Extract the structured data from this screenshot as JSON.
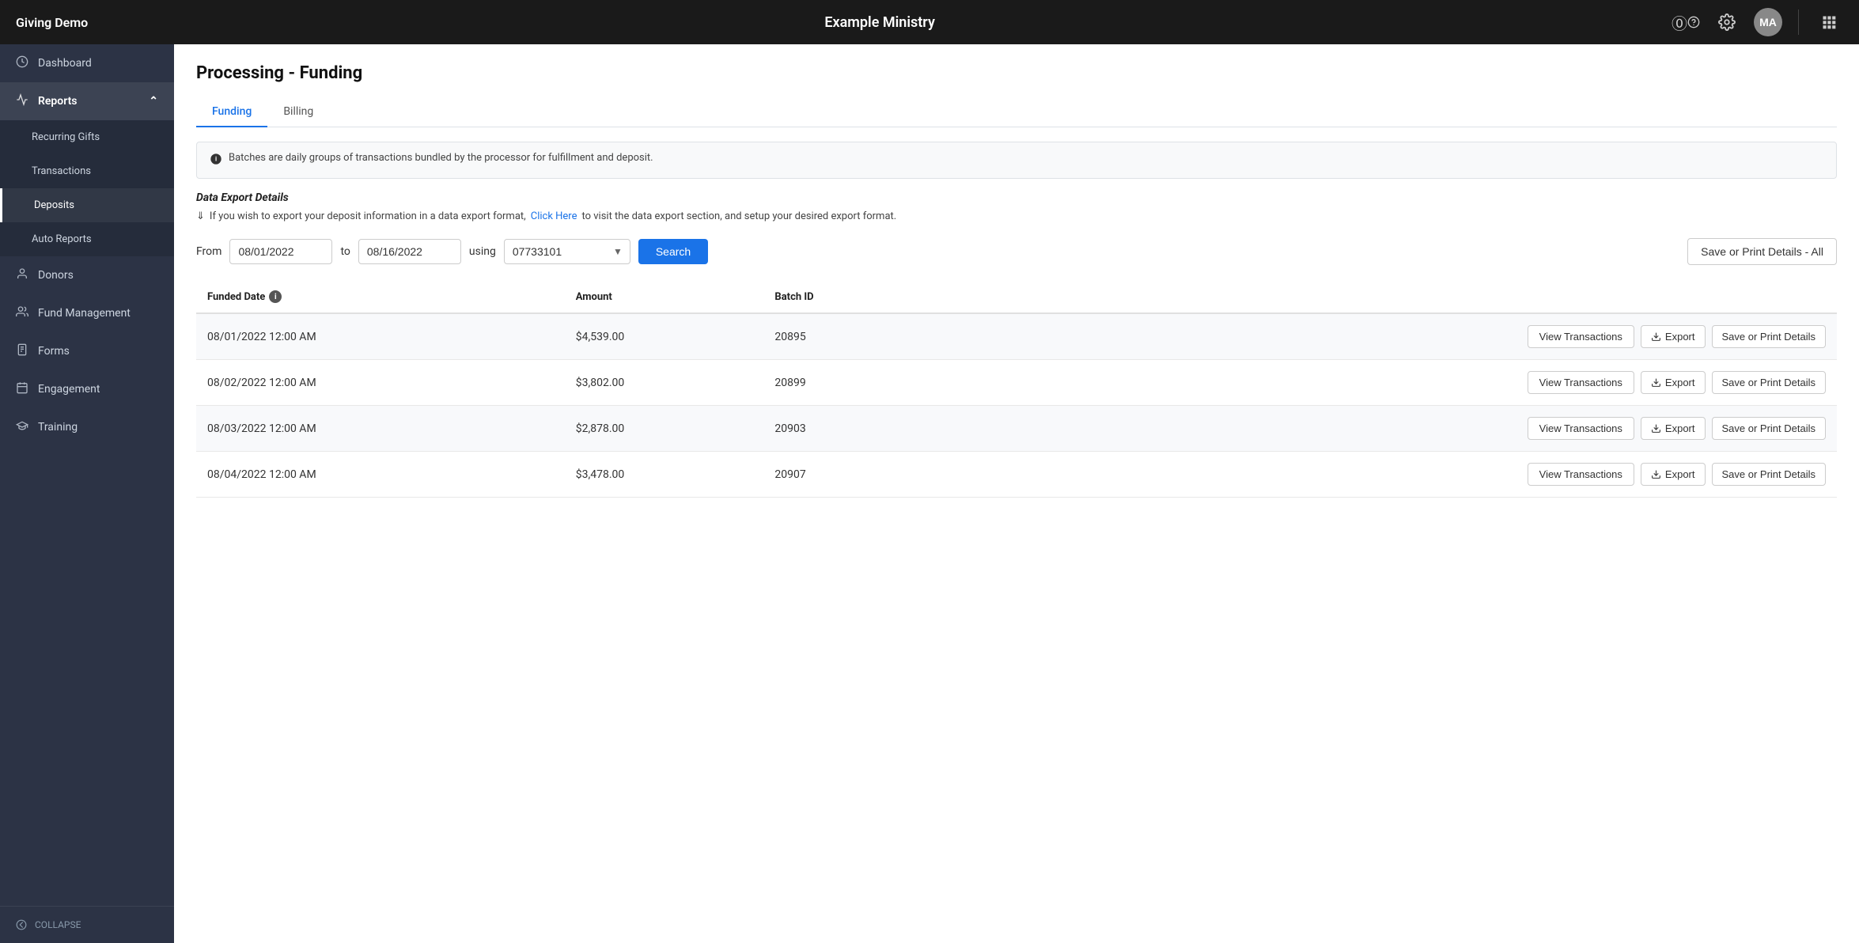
{
  "topnav": {
    "brand": "Giving Demo",
    "title": "Example Ministry",
    "avatar_initials": "MA",
    "help_icon": "?",
    "settings_icon": "⚙"
  },
  "sidebar": {
    "items": [
      {
        "id": "dashboard",
        "label": "Dashboard",
        "icon": "🕐"
      },
      {
        "id": "reports",
        "label": "Reports",
        "icon": "📈",
        "expanded": true
      },
      {
        "id": "recurring-gifts",
        "label": "Recurring Gifts",
        "sub": true
      },
      {
        "id": "transactions",
        "label": "Transactions",
        "sub": true
      },
      {
        "id": "deposits",
        "label": "Deposits",
        "sub": true,
        "active": true
      },
      {
        "id": "auto-reports",
        "label": "Auto Reports",
        "sub": true
      },
      {
        "id": "donors",
        "label": "Donors",
        "icon": "👤"
      },
      {
        "id": "fund-management",
        "label": "Fund Management",
        "icon": "👥"
      },
      {
        "id": "forms",
        "label": "Forms",
        "icon": "📋"
      },
      {
        "id": "engagement",
        "label": "Engagement",
        "icon": "📅"
      },
      {
        "id": "training",
        "label": "Training",
        "icon": "🎓"
      }
    ],
    "collapse_label": "COLLAPSE"
  },
  "page": {
    "title": "Processing - Funding",
    "tabs": [
      {
        "id": "funding",
        "label": "Funding",
        "active": true
      },
      {
        "id": "billing",
        "label": "Billing",
        "active": false
      }
    ],
    "info_text": "Batches are daily groups of transactions bundled by the processor for fulfillment and deposit.",
    "data_export": {
      "title": "Data Export Details",
      "text_before": "If you wish to export your deposit information in a data export format,",
      "link_text": "Click Here",
      "text_after": "to visit the data export section, and setup your desired export format."
    },
    "filter": {
      "from_label": "From",
      "from_value": "08/01/2022",
      "to_label": "to",
      "to_value": "08/16/2022",
      "using_label": "using",
      "using_value": "07733101",
      "search_label": "Search",
      "save_print_all_label": "Save or Print Details - All"
    },
    "table": {
      "columns": [
        {
          "id": "funded_date",
          "label": "Funded Date",
          "has_info": true
        },
        {
          "id": "amount",
          "label": "Amount"
        },
        {
          "id": "batch_id",
          "label": "Batch ID"
        },
        {
          "id": "actions",
          "label": ""
        }
      ],
      "rows": [
        {
          "funded_date": "08/01/2022 12:00 AM",
          "amount": "$4,539.00",
          "batch_id": "20895",
          "view_tx_label": "View Transactions",
          "export_label": "Export",
          "save_print_label": "Save or Print Details"
        },
        {
          "funded_date": "08/02/2022 12:00 AM",
          "amount": "$3,802.00",
          "batch_id": "20899",
          "view_tx_label": "View Transactions",
          "export_label": "Export",
          "save_print_label": "Save or Print Details"
        },
        {
          "funded_date": "08/03/2022 12:00 AM",
          "amount": "$2,878.00",
          "batch_id": "20903",
          "view_tx_label": "View Transactions",
          "export_label": "Export",
          "save_print_label": "Save or Print Details"
        },
        {
          "funded_date": "08/04/2022 12:00 AM",
          "amount": "$3,478.00",
          "batch_id": "20907",
          "view_tx_label": "View Transactions",
          "export_label": "Export",
          "save_print_label": "Save or Print Details"
        }
      ]
    }
  }
}
